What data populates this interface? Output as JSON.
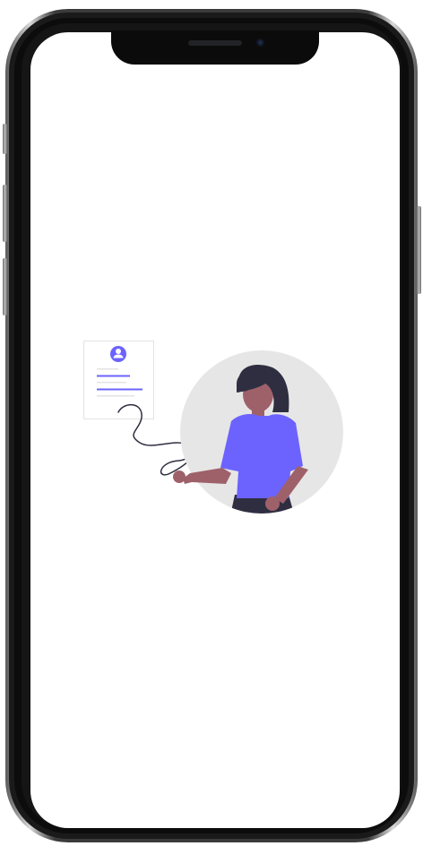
{
  "device": {
    "model_icon": "smartphone-frame",
    "frame_color": "#1a1a1a",
    "screen_color": "#ffffff"
  },
  "illustration": {
    "subject": "woman-signing-document",
    "accent_color": "#6c63ff",
    "circle_color": "#e6e6e6",
    "skin_color": "#9e616a",
    "hair_color": "#2f2e41",
    "document_icon": "profile-document-icon"
  }
}
